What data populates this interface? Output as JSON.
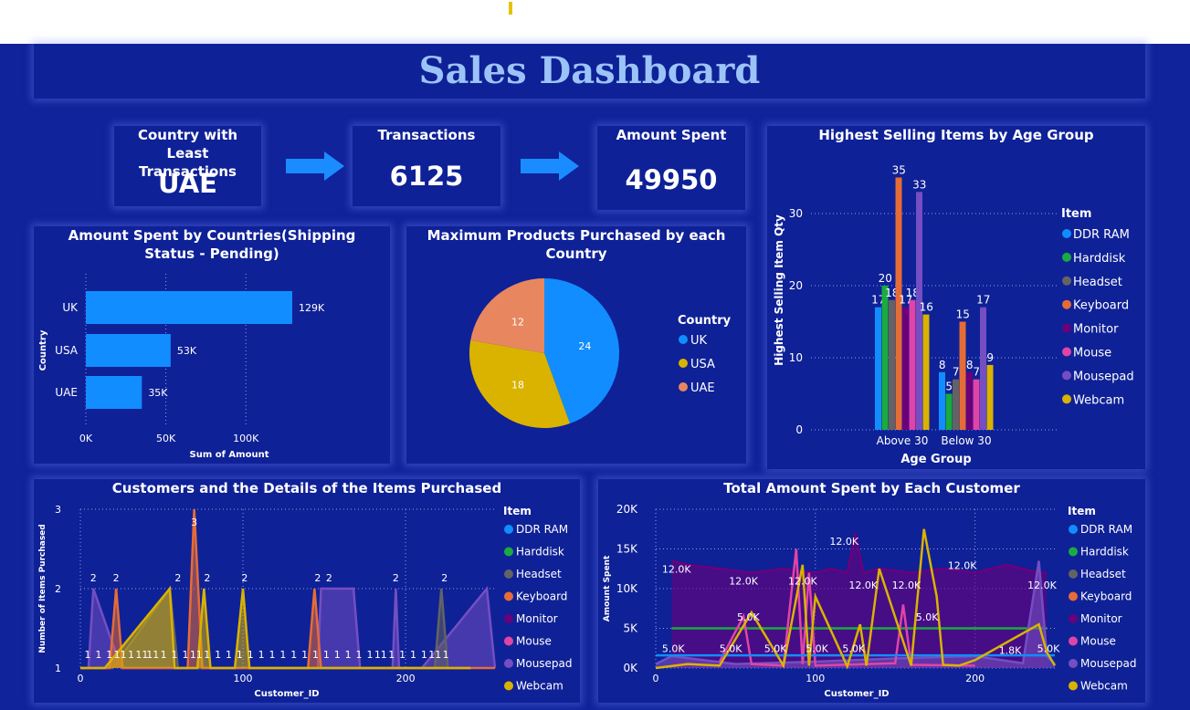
{
  "dashboard": {
    "title": "Sales Dashboard"
  },
  "kpis": [
    {
      "label": "Country with Least Transactions",
      "value": "UAE"
    },
    {
      "label": "Transactions",
      "value": "6125"
    },
    {
      "label": "Amount Spent",
      "value": "49950"
    }
  ],
  "colors": {
    "background": "#10239a",
    "panel": "#0f2196",
    "title_text": "#9cc3f7",
    "arrow": "#1a8cff",
    "DDR RAM": "#118dff",
    "Harddisk": "#1aab40",
    "Headset": "#636363",
    "Keyboard": "#e66c37",
    "Monitor": "#6b007b",
    "Mouse": "#e044a7",
    "Mousepad": "#744ec2",
    "Webcam": "#d9b300",
    "UK": "#118dff",
    "USA": "#d9b300",
    "UAE": "#e8875f"
  },
  "charts": {
    "amount_by_country": {
      "title": "Amount Spent by Countries(Shipping Status - Pending)"
    },
    "products_by_country": {
      "title": "Maximum Products Purchased by each Country"
    },
    "items_by_age": {
      "title": "Highest Selling Items by Age Group"
    },
    "customer_items": {
      "title": "Customers and the Details of the Items Purchased"
    },
    "customer_amount": {
      "title": "Total Amount Spent by Each Customer"
    }
  },
  "chart_data": [
    {
      "type": "bar",
      "orientation": "horizontal",
      "title": "Amount Spent by Countries(Shipping Status - Pending)",
      "categories": [
        "UK",
        "USA",
        "UAE"
      ],
      "values": [
        129000,
        53000,
        35000
      ],
      "value_labels": [
        "129K",
        "53K",
        "35K"
      ],
      "xlabel": "Sum of Amount",
      "ylabel": "Country",
      "xlim": [
        0,
        125000
      ],
      "xticks": [
        "0K",
        "50K",
        "100K"
      ],
      "grid": true
    },
    {
      "type": "pie",
      "title": "Maximum Products Purchased by each Country",
      "legend_title": "Country",
      "labels": [
        "UK",
        "USA",
        "UAE"
      ],
      "values": [
        24,
        18,
        12
      ],
      "legend_position": "right"
    },
    {
      "type": "bar",
      "title": "Highest Selling Items by Age Group",
      "categories": [
        "Above 30",
        "Below 30"
      ],
      "xlabel": "Age Group",
      "ylabel": "Highest Selling Item Qty",
      "ylim": [
        0,
        37
      ],
      "yticks": [
        "0",
        "10",
        "20",
        "30"
      ],
      "legend_title": "Item",
      "legend_position": "right",
      "series": [
        {
          "name": "DDR RAM",
          "values": [
            17,
            8
          ]
        },
        {
          "name": "Harddisk",
          "values": [
            20,
            5
          ]
        },
        {
          "name": "Headset",
          "values": [
            18,
            7
          ]
        },
        {
          "name": "Keyboard",
          "values": [
            35,
            15
          ]
        },
        {
          "name": "Monitor",
          "values": [
            17,
            8
          ]
        },
        {
          "name": "Mouse",
          "values": [
            18,
            7
          ]
        },
        {
          "name": "Mousepad",
          "values": [
            33,
            17
          ]
        },
        {
          "name": "Webcam",
          "values": [
            16,
            9
          ]
        }
      ]
    },
    {
      "type": "area",
      "title": "Customers and the Details of the Items Purchased",
      "xlabel": "Customer_ID",
      "ylabel": "Number of Items Purchased",
      "xlim": [
        0,
        255
      ],
      "ylim": [
        1,
        3
      ],
      "xticks": [
        "0",
        "100",
        "200"
      ],
      "yticks": [
        "1",
        "2",
        "3"
      ],
      "legend_title": "Item",
      "legend_position": "right",
      "series": [
        {
          "name": "Mousepad",
          "x": [
            0,
            5,
            8,
            25,
            140,
            146,
            148,
            168,
            172,
            192,
            194,
            196,
            210,
            250,
            255
          ],
          "y": [
            1,
            1,
            2,
            1,
            1,
            1,
            2,
            2,
            1,
            1,
            2,
            1,
            1,
            2,
            1
          ]
        },
        {
          "name": "Headset",
          "x": [
            0,
            20,
            55,
            60,
            218,
            222,
            226,
            240
          ],
          "y": [
            1,
            1,
            2,
            1,
            1,
            2,
            1,
            1
          ]
        },
        {
          "name": "Keyboard",
          "x": [
            0,
            18,
            22,
            26,
            66,
            70,
            75,
            140,
            144,
            148,
            255
          ],
          "y": [
            1,
            1,
            2,
            1,
            1,
            3,
            1,
            1,
            2,
            1,
            1
          ]
        },
        {
          "name": "Webcam",
          "x": [
            0,
            15,
            55,
            58,
            72,
            76,
            80,
            95,
            100,
            104,
            240
          ],
          "y": [
            1,
            1,
            2,
            1,
            1,
            2,
            1,
            1,
            2,
            1,
            1
          ]
        }
      ],
      "point_labels": [
        {
          "x": 8,
          "y": 2,
          "text": "2"
        },
        {
          "x": 22,
          "y": 2,
          "text": "2"
        },
        {
          "x": 60,
          "y": 2,
          "text": "2"
        },
        {
          "x": 70,
          "y": 3,
          "text": "3"
        },
        {
          "x": 78,
          "y": 2,
          "text": "2"
        },
        {
          "x": 101,
          "y": 2,
          "text": "2"
        },
        {
          "x": 146,
          "y": 2,
          "text": "2"
        },
        {
          "x": 153,
          "y": 2,
          "text": "2"
        },
        {
          "x": 194,
          "y": 2,
          "text": "2"
        },
        {
          "x": 224,
          "y": 2,
          "text": "2"
        }
      ],
      "baseline_labels": [
        "1",
        "1",
        "1",
        "11",
        "1",
        "11",
        "11",
        "1",
        "1",
        "1",
        "11",
        "1",
        "1",
        "1",
        "1",
        "1",
        "1",
        "1",
        "1",
        "1",
        "1",
        "1",
        "1",
        "1",
        "1",
        "1",
        "1",
        "11",
        "1",
        "1",
        "1",
        "1",
        "11",
        "1"
      ]
    },
    {
      "type": "area",
      "title": "Total Amount Spent by Each Customer",
      "xlabel": "Customer_ID",
      "ylabel": "Amount Spent",
      "xlim": [
        0,
        250
      ],
      "ylim": [
        0,
        20000
      ],
      "xticks": [
        "0",
        "100",
        "200"
      ],
      "yticks": [
        "0K",
        "5K",
        "10K",
        "15K",
        "20K"
      ],
      "legend_title": "Item",
      "legend_position": "right",
      "series": [
        {
          "name": "Monitor",
          "x": [
            10,
            20,
            40,
            60,
            80,
            100,
            110,
            120,
            125,
            130,
            140,
            160,
            180,
            200,
            220,
            240,
            245
          ],
          "y": [
            13500,
            13000,
            12500,
            12000,
            12500,
            12000,
            12500,
            12000,
            17000,
            12000,
            12500,
            12000,
            12500,
            12000,
            13000,
            12000,
            12000
          ]
        },
        {
          "name": "Harddisk",
          "x": [
            10,
            60,
            70,
            130,
            245
          ],
          "y": [
            5000,
            5000,
            5000,
            5000,
            5000
          ]
        },
        {
          "name": "Mousepad",
          "x": [
            0,
            10,
            50,
            100,
            150,
            200,
            230,
            240,
            245,
            250
          ],
          "y": [
            500,
            1500,
            500,
            800,
            1200,
            1500,
            600,
            13500,
            1500,
            500
          ]
        },
        {
          "name": "Mouse",
          "x": [
            40,
            55,
            60,
            80,
            88,
            92,
            96,
            100,
            150,
            155,
            160,
            200
          ],
          "y": [
            800,
            6500,
            500,
            300,
            15000,
            500,
            12000,
            300,
            600,
            8000,
            400,
            300
          ]
        },
        {
          "name": "DDR RAM",
          "x": [
            0,
            250
          ],
          "y": [
            1600,
            1600
          ]
        },
        {
          "name": "Webcam",
          "x": [
            0,
            20,
            40,
            60,
            80,
            92,
            96,
            100,
            120,
            128,
            132,
            140,
            160,
            168,
            176,
            180,
            190,
            200,
            240,
            245,
            250
          ],
          "y": [
            0,
            500,
            300,
            7000,
            300,
            13000,
            300,
            9000,
            200,
            5500,
            300,
            12500,
            300,
            17500,
            9000,
            400,
            300,
            1000,
            5500,
            2000,
            300
          ]
        }
      ],
      "point_labels": [
        {
          "x": 13,
          "y": 12000,
          "text": "12.0K"
        },
        {
          "x": 55,
          "y": 10500,
          "text": "12.0K"
        },
        {
          "x": 92,
          "y": 10500,
          "text": "12.0K"
        },
        {
          "x": 118,
          "y": 15500,
          "text": "12.0K"
        },
        {
          "x": 130,
          "y": 10000,
          "text": "12.0K"
        },
        {
          "x": 157,
          "y": 10000,
          "text": "12.0K"
        },
        {
          "x": 192,
          "y": 12500,
          "text": "12.0K"
        },
        {
          "x": 242,
          "y": 10000,
          "text": "12.0K"
        },
        {
          "x": 58,
          "y": 6000,
          "text": "5.0K"
        },
        {
          "x": 170,
          "y": 6000,
          "text": "5.0K"
        },
        {
          "x": 11,
          "y": 2000,
          "text": "5.0K"
        },
        {
          "x": 47,
          "y": 2000,
          "text": "5.0K"
        },
        {
          "x": 75,
          "y": 2000,
          "text": "5.0K"
        },
        {
          "x": 101,
          "y": 2000,
          "text": "5.0K"
        },
        {
          "x": 124,
          "y": 2000,
          "text": "5.0K"
        },
        {
          "x": 222,
          "y": 1800,
          "text": "1.8K"
        },
        {
          "x": 246,
          "y": 2000,
          "text": "5.0K"
        }
      ]
    }
  ]
}
